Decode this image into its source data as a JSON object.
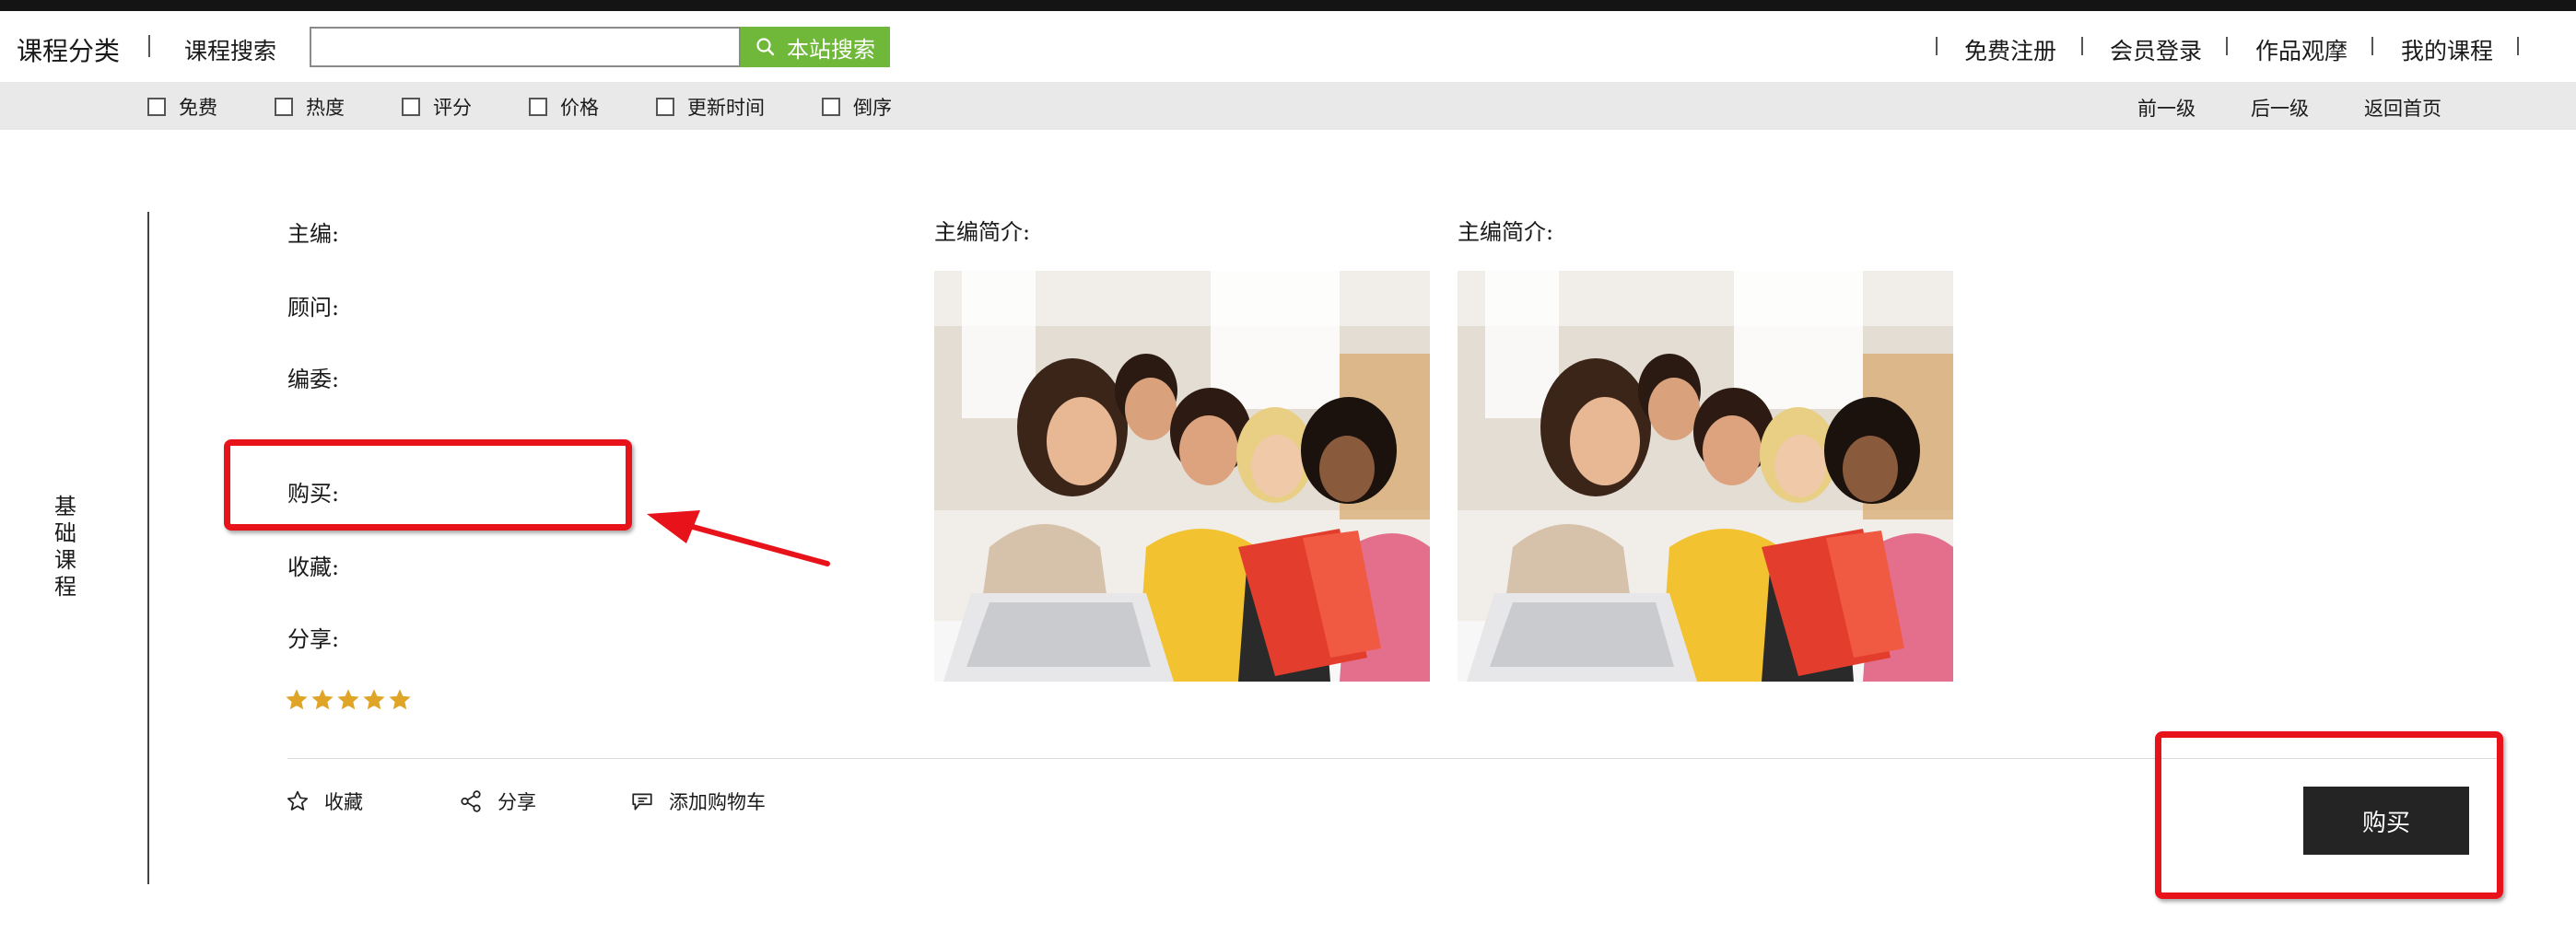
{
  "header": {
    "brand": "课程分类",
    "search_label": "课程搜索",
    "search_value": "",
    "search_placeholder": "",
    "search_button": "本站搜索",
    "nav": [
      "免费注册",
      "会员登录",
      "作品观摩",
      "我的课程"
    ]
  },
  "filters": [
    "免费",
    "热度",
    "评分",
    "价格",
    "更新时间",
    "倒序"
  ],
  "level_nav": [
    "前一级",
    "后一级",
    "返回首页"
  ],
  "category": "基础课程",
  "info": {
    "editor": "主编:",
    "advisor": "顾问:",
    "committee": "编委:",
    "buy": "购买:",
    "favorite": "收藏:",
    "share": "分享:"
  },
  "rating": {
    "stars": 5,
    "max": 5,
    "color": "#e0a526"
  },
  "images": [
    {
      "label": "主编简介:"
    },
    {
      "label": "主编简介:"
    }
  ],
  "actions": {
    "favorite": "收藏",
    "share": "分享",
    "cart": "添加购物车"
  },
  "buy_button": "购买",
  "colors": {
    "search_button": "#6fb83a",
    "filter_bar": "#e9e9e9",
    "buy_button": "#242424",
    "annotation": "#e8131a"
  }
}
